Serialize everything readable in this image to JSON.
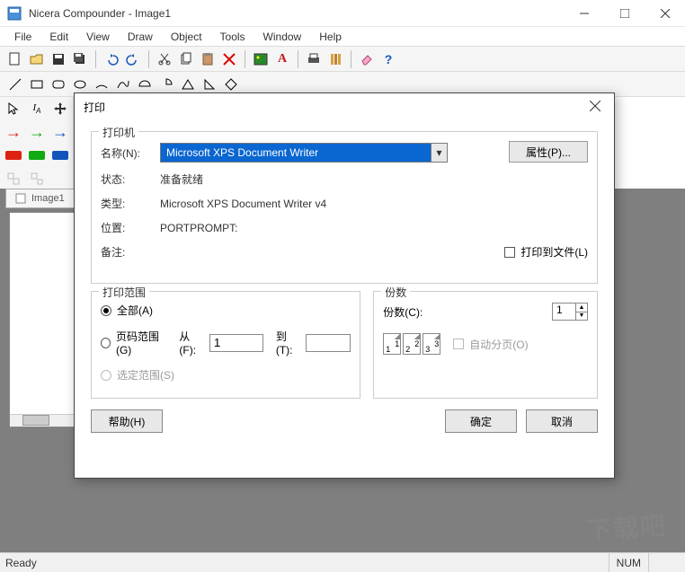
{
  "window": {
    "title": "Nicera Compounder - Image1",
    "menu": [
      "File",
      "Edit",
      "View",
      "Draw",
      "Object",
      "Tools",
      "Window",
      "Help"
    ]
  },
  "document": {
    "tab": "Image1"
  },
  "status": {
    "left": "Ready",
    "right": "NUM"
  },
  "dialog": {
    "title": "打印",
    "printer": {
      "legend": "打印机",
      "name_label": "名称(N):",
      "name_value": "Microsoft XPS Document Writer",
      "properties_btn": "属性(P)...",
      "status_label": "状态:",
      "status_value": "准备就绪",
      "type_label": "类型:",
      "type_value": "Microsoft XPS Document Writer v4",
      "where_label": "位置:",
      "where_value": "PORTPROMPT:",
      "comment_label": "备注:",
      "to_file_label": "打印到文件(L)"
    },
    "range": {
      "legend": "打印范围",
      "all": "全部(A)",
      "pages": "页码范围(G)",
      "from_label": "从(F):",
      "from_value": "1",
      "to_label": "到(T):",
      "to_value": "",
      "selection": "选定范围(S)"
    },
    "copies": {
      "legend": "份数",
      "count_label": "份数(C):",
      "count_value": "1",
      "collate_label": "自动分页(O)"
    },
    "buttons": {
      "help": "帮助(H)",
      "ok": "确定",
      "cancel": "取消"
    }
  },
  "watermark": "下载吧"
}
